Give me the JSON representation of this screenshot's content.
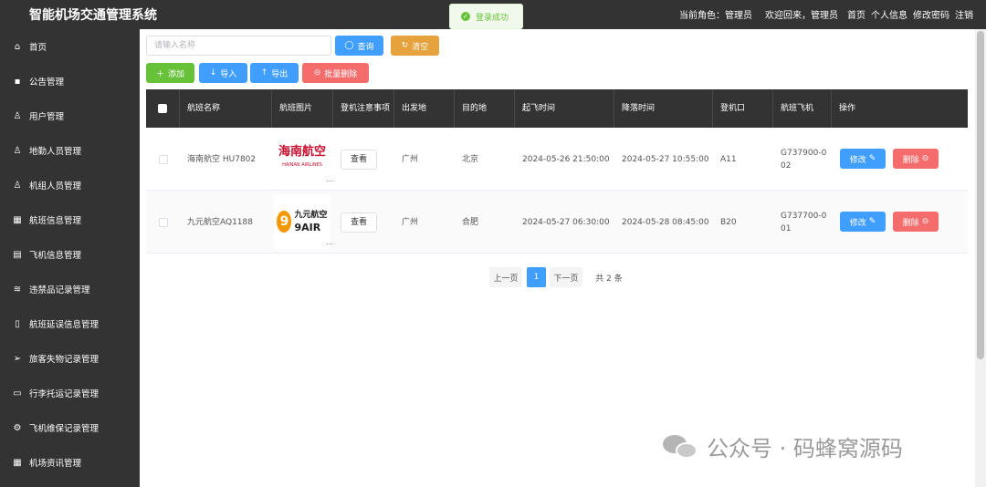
{
  "header": {
    "app_title": "智能机场交通管理系统",
    "role_text": "当前角色：管理员",
    "welcome_text": "欢迎回来，管理员",
    "nav": [
      "首页",
      "个人信息",
      "修改密码",
      "注销"
    ]
  },
  "toast": {
    "text": "登录成功",
    "color": "#67c23a"
  },
  "sidebar": {
    "items": [
      {
        "label": "首页",
        "icon": "home-icon",
        "glyph": "⌂"
      },
      {
        "label": "公告管理",
        "icon": "message-icon",
        "glyph": "▪"
      },
      {
        "label": "用户管理",
        "icon": "user-icon",
        "glyph": "♙"
      },
      {
        "label": "地勤人员管理",
        "icon": "user-icon",
        "glyph": "♙"
      },
      {
        "label": "机组人员管理",
        "icon": "user-icon",
        "glyph": "♙"
      },
      {
        "label": "航班信息管理",
        "icon": "grid-icon",
        "glyph": "▦"
      },
      {
        "label": "飞机信息管理",
        "icon": "document-icon",
        "glyph": "▤"
      },
      {
        "label": "违禁品记录管理",
        "icon": "database-icon",
        "glyph": "≋"
      },
      {
        "label": "航班延误信息管理",
        "icon": "notebook-icon",
        "glyph": "▯"
      },
      {
        "label": "旅客失物记录管理",
        "icon": "send-icon",
        "glyph": "➢"
      },
      {
        "label": "行李托运记录管理",
        "icon": "card-icon",
        "glyph": "▭"
      },
      {
        "label": "飞机维保记录管理",
        "icon": "gear-icon",
        "glyph": "⚙"
      },
      {
        "label": "机场资讯管理",
        "icon": "grid-icon",
        "glyph": "▦"
      }
    ]
  },
  "search": {
    "placeholder": "请输入名称",
    "query_label": "查询",
    "clear_label": "清空"
  },
  "toolbar": {
    "add_label": "添加",
    "import_label": "导入",
    "export_label": "导出",
    "batch_delete_label": "批量删除"
  },
  "table": {
    "columns": [
      "航班名称",
      "航班图片",
      "登机注意事项",
      "出发地",
      "目的地",
      "起飞时间",
      "降落时间",
      "登机口",
      "航班飞机",
      "操作"
    ],
    "view_label": "查看",
    "edit_label": "修改",
    "delete_label": "删除",
    "rows": [
      {
        "name": "海南航空 HU7802",
        "logo_cn": "海南航空",
        "logo_en": "HAINAN AIRLINES",
        "from": "广州",
        "to": "北京",
        "depart": "2024-05-26 21:50:00",
        "arrive": "2024-05-27 10:55:00",
        "gate": "A11",
        "plane_a": "G737900-0",
        "plane_b": "02"
      },
      {
        "name": "九元航空AQ1188",
        "logo_cn": "九元航空",
        "logo_en": "9AIR",
        "from": "广州",
        "to": "合肥",
        "depart": "2024-05-27 06:30:00",
        "arrive": "2024-05-28 08:45:00",
        "gate": "B20",
        "plane_a": "G737700-0",
        "plane_b": "01"
      }
    ]
  },
  "pagination": {
    "prev": "上一页",
    "current": "1",
    "next": "下一页",
    "total": "共 2 条"
  },
  "watermark": {
    "text": "公众号 · 码蜂窝源码"
  },
  "colors": {
    "sidebar_bg": "#333333",
    "primary": "#409eff",
    "danger": "#f56c6c",
    "success": "#67c23a",
    "warning": "#e6a23c"
  }
}
